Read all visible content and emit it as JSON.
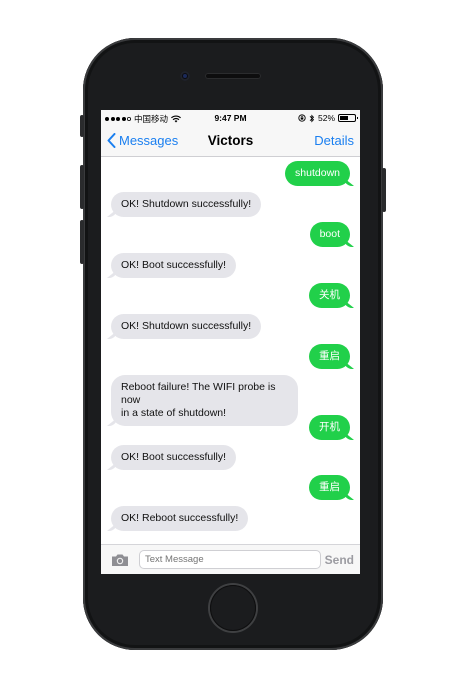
{
  "status_bar": {
    "carrier": "中国移动",
    "time": "9:47 PM",
    "battery": "52%"
  },
  "nav": {
    "back_label": "Messages",
    "title": "Victors",
    "details_label": "Details"
  },
  "messages": [
    {
      "direction": "outgoing",
      "text": "shutdown"
    },
    {
      "direction": "incoming",
      "text": "OK! Shutdown successfully!"
    },
    {
      "direction": "outgoing",
      "text": "boot"
    },
    {
      "direction": "incoming",
      "text": "OK! Boot successfully!"
    },
    {
      "direction": "outgoing",
      "text": "关机"
    },
    {
      "direction": "incoming",
      "text": "OK! Shutdown successfully!"
    },
    {
      "direction": "outgoing",
      "text": "重启"
    },
    {
      "direction": "incoming",
      "text": "Reboot failure! The WIFI probe is now\nin a state of shutdown!"
    },
    {
      "direction": "outgoing",
      "text": "开机"
    },
    {
      "direction": "incoming",
      "text": "OK! Boot successfully!"
    },
    {
      "direction": "outgoing",
      "text": "重启"
    },
    {
      "direction": "incoming",
      "text": "OK! Reboot successfully!"
    }
  ],
  "composer": {
    "placeholder": "Text Message",
    "send_label": "Send"
  }
}
